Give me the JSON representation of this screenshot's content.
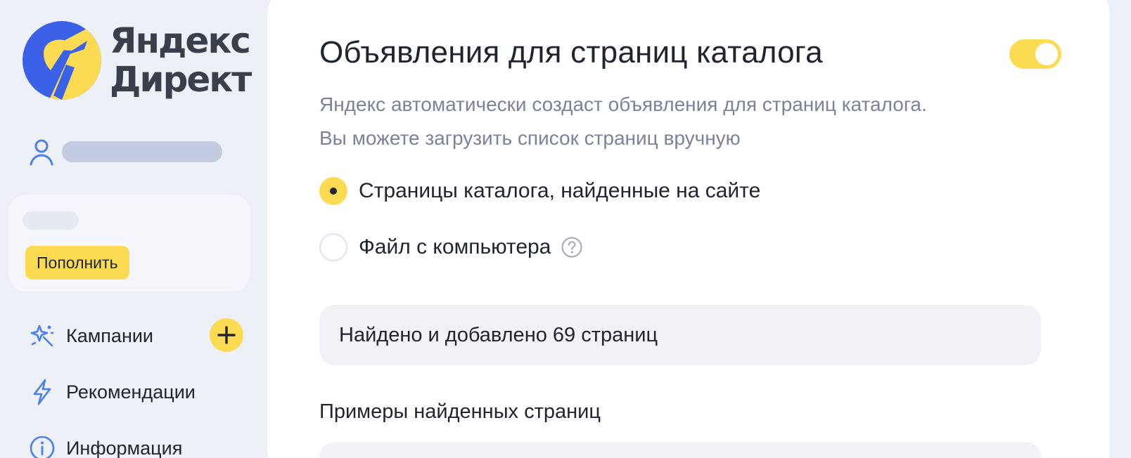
{
  "logo": {
    "line1": "Яндекс",
    "line2": "Директ",
    "brand_blue": "#3a61e8",
    "brand_yellow": "#fcdb53"
  },
  "user": {
    "icon": "user-icon"
  },
  "balance": {
    "topup_label": "Пополнить"
  },
  "nav": {
    "campaigns": {
      "label": "Кампании",
      "icon": "sparkle-icon"
    },
    "recommendations": {
      "label": "Рекомендации",
      "icon": "lightning-icon"
    },
    "info": {
      "label": "Информация",
      "icon": "info-icon"
    },
    "add_icon": "plus-icon"
  },
  "panel": {
    "title": "Объявления для страниц каталога",
    "toggle_on": true,
    "description_line1": "Яндекс автоматически создаст объявления для страниц каталога.",
    "description_line2": "Вы можете загрузить список страниц вручную",
    "options": [
      {
        "label": "Страницы каталога, найденные на сайте",
        "selected": true
      },
      {
        "label": "Файл с компьютера",
        "selected": false,
        "help_icon": "question-icon"
      }
    ],
    "found_text": "Найдено и добавлено 69 страниц",
    "examples_title": "Примеры найденных страниц"
  },
  "colors": {
    "accent": "#fcdb53",
    "page_bg": "#edf0f7",
    "icon_blue": "#4a7ff0",
    "muted_text": "#7b829b"
  }
}
